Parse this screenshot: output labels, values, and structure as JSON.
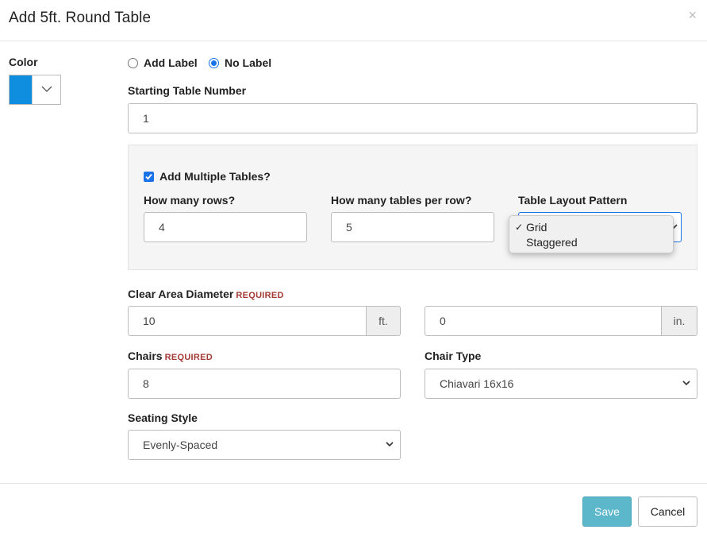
{
  "modal": {
    "title": "Add 5ft. Round Table",
    "close_label": "×"
  },
  "color": {
    "label": "Color",
    "value": "#0f8ee0"
  },
  "label_mode": {
    "options": [
      "Add Label",
      "No Label"
    ],
    "selected": "No Label"
  },
  "starting_table": {
    "label": "Starting Table Number",
    "value": "1"
  },
  "multiple": {
    "checkbox_label": "Add Multiple Tables?",
    "checked": true,
    "rows_label": "How many rows?",
    "rows_value": "4",
    "per_row_label": "How many tables per row?",
    "per_row_value": "5",
    "layout_label": "Table Layout Pattern",
    "layout_options": [
      "Grid",
      "Staggered"
    ],
    "layout_selected": "Grid"
  },
  "clear_area": {
    "label": "Clear Area Diameter",
    "required": "REQUIRED",
    "ft_value": "10",
    "ft_unit": "ft.",
    "in_value": "0",
    "in_unit": "in."
  },
  "chairs": {
    "label": "Chairs",
    "required": "REQUIRED",
    "value": "8"
  },
  "chair_type": {
    "label": "Chair Type",
    "value": "Chiavari 16x16"
  },
  "seating_style": {
    "label": "Seating Style",
    "value": "Evenly-Spaced"
  },
  "footer": {
    "save_label": "Save",
    "cancel_label": "Cancel"
  },
  "colors": {
    "accent": "#1a73e8",
    "save_button": "#5bb7c9",
    "required_text": "#a53a34"
  }
}
